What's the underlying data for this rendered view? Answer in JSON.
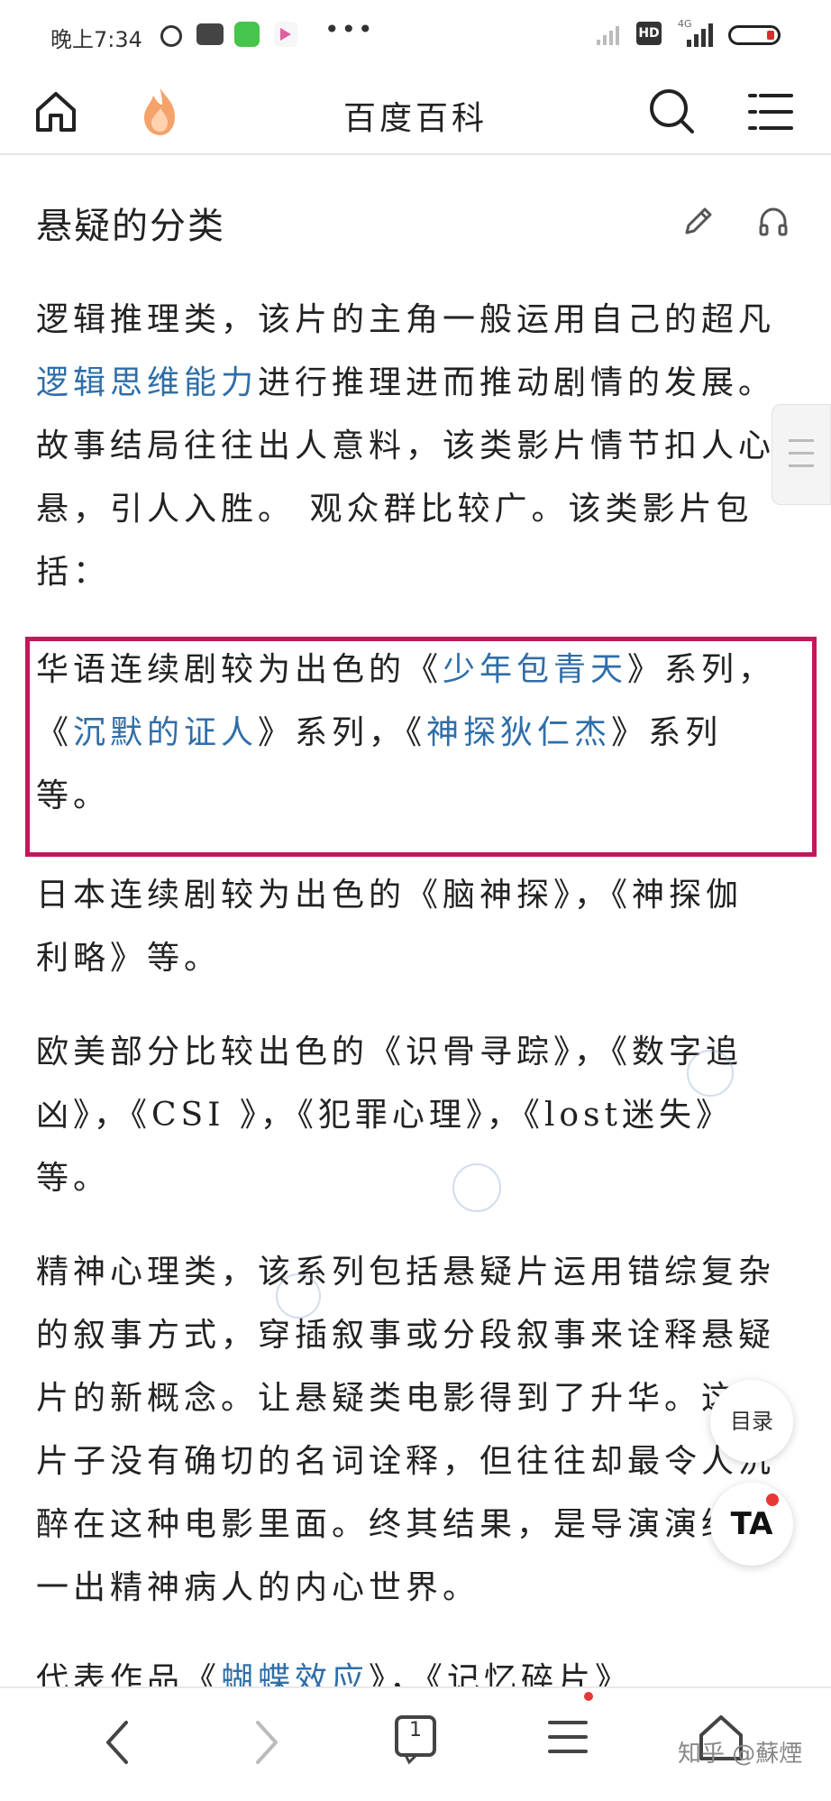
{
  "status_bar": {
    "time": "晚上7:34",
    "hd": "HD",
    "network": "4G",
    "more": "•••"
  },
  "header": {
    "title": "百度百科"
  },
  "section": {
    "title": "悬疑的分类"
  },
  "paragraphs": {
    "p1": {
      "a": "逻辑推理类，该片的主角一般运用自己的超凡",
      "link": "逻辑思维能力",
      "b": "进行推理进而推动剧情的发展。故事结局往往出人意料，该类影片情节扣人心悬，引人入胜。 观众群比较广。该类影片包括："
    },
    "p2": {
      "a": "华语连续剧较为出色的《",
      "link1": "少年包青天",
      "b": "》系列，《",
      "link2": "沉默的证人",
      "c": "》系列，《",
      "link3": "神探狄仁杰",
      "d": "》系列等。"
    },
    "p3": "日本连续剧较为出色的《脑神探》，《神探伽利略》等。",
    "p4": "欧美部分比较出色的《识骨寻踪》，《数字追凶》，《CSI 》，《犯罪心理》，《lost迷失》等。",
    "p5": "精神心理类，该系列包括悬疑片运用错综复杂的叙事方式，穿插叙事或分段叙事来诠释悬疑片的新概念。让悬疑类电影得到了升华。这类片子没有确切的名词诠释，但往往却最令人沉醉在这种电影里面。终其结果，是导演演绎了一出精神病人的内心世界。",
    "p6_partial": {
      "a": "代表作品《",
      "link": "蝴蝶效应",
      "b": "》，《记忆碎片》"
    }
  },
  "floating": {
    "toc": "目录",
    "ta": "TA"
  },
  "bottom_bar": {
    "page_count": "1"
  },
  "watermark": "知乎 @蘇煙",
  "colors": {
    "link": "#2f6ea8",
    "highlight": "#c2185b",
    "badge": "#e53935"
  }
}
